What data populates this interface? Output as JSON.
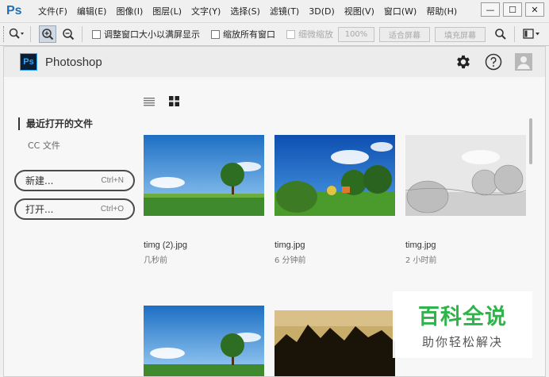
{
  "menubar": {
    "logo": "Ps",
    "items": [
      "文件(F)",
      "编辑(E)",
      "图像(I)",
      "图层(L)",
      "文字(Y)",
      "选择(S)",
      "滤镜(T)",
      "3D(D)",
      "视图(V)",
      "窗口(W)",
      "帮助(H)"
    ],
    "window_buttons": {
      "minimize": "—",
      "restore": "☐",
      "close": "✕"
    }
  },
  "options_bar": {
    "checkbox_resize": "调整窗口大小以满屏显示",
    "checkbox_zoom_all": "缩放所有窗口",
    "checkbox_scrubby": "细微缩放",
    "btn_100": "100%",
    "btn_fit": "适合屏幕",
    "btn_fill": "填充屏幕"
  },
  "start": {
    "logo": "Ps",
    "title": "Photoshop",
    "recent_label": "最近打开的文件",
    "cc_label": "CC 文件",
    "new_label": "新建...",
    "new_shortcut": "Ctrl+N",
    "open_label": "打开...",
    "open_shortcut": "Ctrl+O",
    "files": [
      {
        "name": "timg (2).jpg",
        "time": "几秒前"
      },
      {
        "name": "timg.jpg",
        "time": "6 分钟前"
      },
      {
        "name": "timg.jpg",
        "time": "2 小时前"
      }
    ]
  },
  "watermark": {
    "main": "百科全说",
    "sub": "助你轻松解决"
  },
  "colors": {
    "ps_blue": "#31a8ff",
    "ps_dark": "#0a1f33",
    "watermark_green": "#2fb44a"
  }
}
